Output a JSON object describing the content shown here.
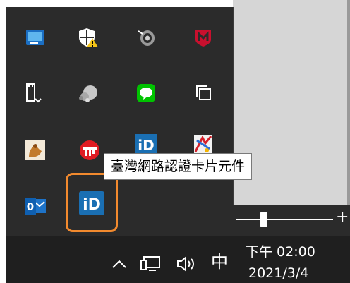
{
  "tray": {
    "icons": [
      {
        "name": "intel-graphics-icon"
      },
      {
        "name": "windows-security-warning-icon"
      },
      {
        "name": "speaker-icon"
      },
      {
        "name": "mcafee-icon"
      },
      {
        "name": "usb-safely-remove-icon"
      },
      {
        "name": "cloud-sync-icon"
      },
      {
        "name": "line-chat-icon"
      },
      {
        "name": "copy-windows-icon"
      },
      {
        "name": "hand-app-icon"
      },
      {
        "name": "red-circle-app-icon"
      },
      {
        "name": "id-card-icon"
      },
      {
        "name": "colorful-app-icon"
      },
      {
        "name": "outlook-icon"
      },
      {
        "name": "id-card-icon"
      }
    ],
    "id_badge_text": "iD",
    "outlook_badge_text": "0"
  },
  "tooltip": {
    "text": "臺灣網路認證卡片元件"
  },
  "taskbar": {
    "ime": "中",
    "time": "下午 02:00",
    "date": "2021/3/4",
    "caret": "^"
  },
  "colors": {
    "panel_bg": "#2b2b2b",
    "taskbar_bg": "#1f1f1f",
    "highlight": "#f28a2e",
    "id_blue": "#1a6fb3"
  }
}
